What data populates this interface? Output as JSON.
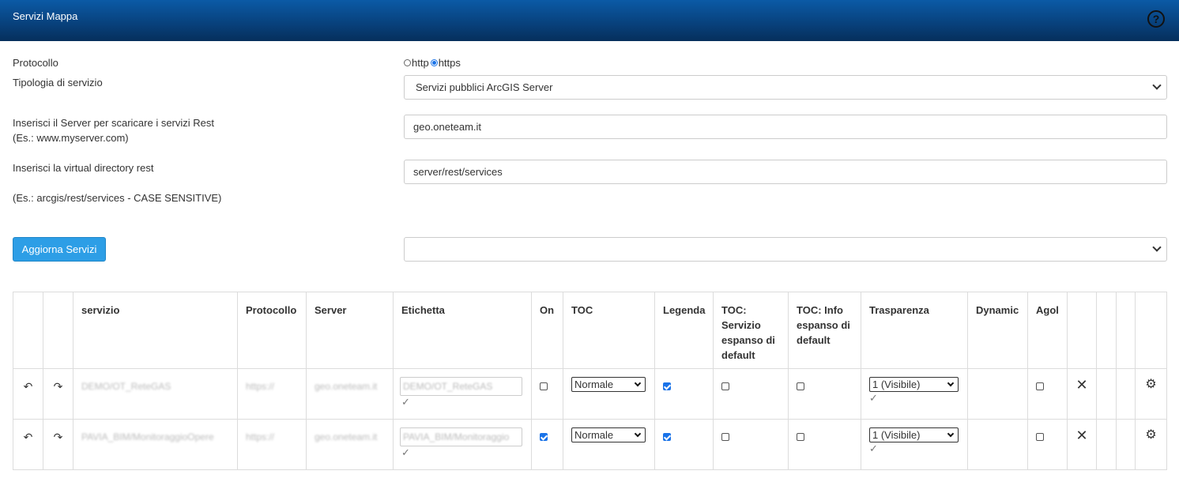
{
  "header": {
    "title": "Servizi Mappa",
    "help_icon": "?"
  },
  "form": {
    "protocol_label": "Protocollo",
    "protocol_options": [
      "http",
      "https"
    ],
    "protocol_selected": "https",
    "service_type_label": "Tipologia di servizio",
    "service_type_value": "Servizi pubblici ArcGIS Server",
    "server_label": "Inserisci il Server per scaricare i servizi Rest",
    "server_hint": "(Es.: www.myserver.com)",
    "server_value": "geo.oneteam.it",
    "vdir_label": "Inserisci la virtual directory rest",
    "vdir_hint": "(Es.: arcgis/rest/services - CASE SENSITIVE)",
    "vdir_value": "server/rest/services",
    "update_button": "Aggiorna Servizi",
    "services_select_value": ""
  },
  "table": {
    "headers": [
      "",
      "",
      "servizio",
      "Protocollo",
      "Server",
      "Etichetta",
      "On",
      "TOC",
      "Legenda",
      "TOC: Servizio espanso di default",
      "TOC: Info espanso di default",
      "Trasparenza",
      "Dynamic",
      "Agol",
      "",
      "",
      "",
      ""
    ],
    "rows": [
      {
        "service": "DEMO/OT_ReteGAS",
        "protocol": "https://",
        "server": "geo.oneteam.it",
        "label": "DEMO/OT_ReteGAS",
        "on": false,
        "toc": "Normale",
        "legend": true,
        "toc_service_expanded": false,
        "toc_info_expanded": false,
        "transparency": "1 (Visibile)",
        "agol": false
      },
      {
        "service": "PAVIA_BIM/MonitoraggioOpere",
        "protocol": "https://",
        "server": "geo.oneteam.it",
        "label": "PAVIA_BIM/Monitoraggio",
        "on": true,
        "toc": "Normale",
        "legend": true,
        "toc_service_expanded": false,
        "toc_info_expanded": false,
        "transparency": "1 (Visibile)",
        "agol": false
      }
    ],
    "icons": {
      "move_up": "↶",
      "move_down": "↷",
      "checkmark": "✓",
      "delete": "✕",
      "settings": "⚙"
    }
  }
}
